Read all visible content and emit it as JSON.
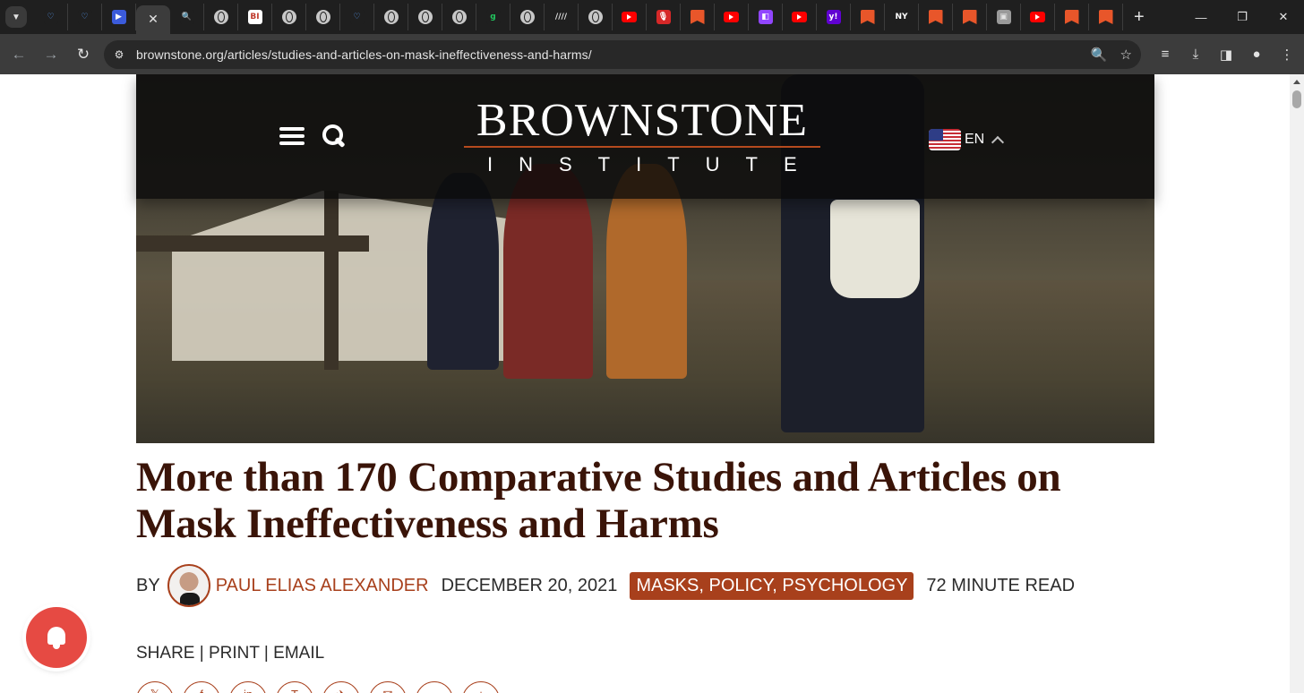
{
  "browser": {
    "tab_search_icon": "chevron-down-icon",
    "tabs": [
      {
        "icon": "bookmark-blue-icon",
        "glyph": "♡",
        "bg": "#1f1f1f",
        "fg": "#5aa0ff"
      },
      {
        "icon": "bookmark-blue-icon",
        "glyph": "♡",
        "bg": "#1f1f1f",
        "fg": "#5aa0ff"
      },
      {
        "icon": "arrow-tag-icon",
        "glyph": "▶",
        "bg": "#3b5bdb",
        "fg": "#ffffff"
      },
      {
        "icon": "close-icon",
        "glyph": "✕",
        "active": true
      },
      {
        "icon": "search-icon",
        "glyph": "🔍",
        "bg": "#1f1f1f",
        "fg": "#5aa0ff"
      },
      {
        "icon": "globe-icon"
      },
      {
        "icon": "bi-logo-icon",
        "glyph": "BI",
        "bg": "#ffffff",
        "fg": "#c0392b"
      },
      {
        "icon": "globe-icon"
      },
      {
        "icon": "globe-icon"
      },
      {
        "icon": "bookmark-blue-icon",
        "glyph": "♡",
        "bg": "#1f1f1f",
        "fg": "#5aa0ff"
      },
      {
        "icon": "globe-icon"
      },
      {
        "icon": "globe-icon"
      },
      {
        "icon": "globe-icon"
      },
      {
        "icon": "g-logo-icon",
        "glyph": "g",
        "bg": "#1f1f1f",
        "fg": "#22c55e"
      },
      {
        "icon": "globe-icon"
      },
      {
        "icon": "slashes-icon",
        "glyph": "////",
        "bg": "#1f1f1f",
        "fg": "#e3e3e3"
      },
      {
        "icon": "globe-icon"
      },
      {
        "icon": "youtube-icon"
      },
      {
        "icon": "podcast-icon",
        "glyph": "🎙",
        "bg": "#d62828",
        "fg": "#ffffff"
      },
      {
        "icon": "substack-icon"
      },
      {
        "icon": "youtube-icon"
      },
      {
        "icon": "twitch-icon",
        "glyph": "◧",
        "bg": "#9146ff",
        "fg": "#ffffff"
      },
      {
        "icon": "youtube-icon"
      },
      {
        "icon": "yahoo-icon",
        "glyph": "y!",
        "bg": "#6001d2",
        "fg": "#ffffff"
      },
      {
        "icon": "substack-icon"
      },
      {
        "icon": "nyt-icon",
        "glyph": "NY",
        "bg": "#1f1f1f",
        "fg": "#ffffff"
      },
      {
        "icon": "substack-icon"
      },
      {
        "icon": "substack-icon"
      },
      {
        "icon": "photo-icon",
        "glyph": "▣",
        "bg": "#9a9a9a",
        "fg": "#e3e3e3"
      },
      {
        "icon": "youtube-icon"
      },
      {
        "icon": "substack-icon"
      },
      {
        "icon": "substack-icon"
      }
    ],
    "new_tab_icon": "plus-icon",
    "url": "brownstone.org/articles/studies-and-articles-on-mask-ineffectiveness-and-harms/"
  },
  "site": {
    "logo_top": "BROWNSTONE",
    "logo_bottom": "INSTITUTE",
    "language": "EN",
    "accent_color": "#a8401c"
  },
  "article": {
    "title": "More than 170 Comparative Studies and Articles on Mask Ineffectiveness and Harms",
    "by_label": "BY",
    "author": "PAUL ELIAS ALEXANDER",
    "date": "DECEMBER 20, 2021",
    "tags": "MASKS, POLICY, PSYCHOLOGY",
    "read_time": "72 MINUTE READ",
    "share": {
      "share": "SHARE",
      "print": "PRINT",
      "email": "EMAIL",
      "separator": " | "
    },
    "share_icons": [
      {
        "icon": "twitter-icon",
        "glyph": "𝕏"
      },
      {
        "icon": "facebook-icon",
        "glyph": "f"
      },
      {
        "icon": "linkedin-icon",
        "glyph": "in"
      },
      {
        "icon": "truth-social-icon",
        "glyph": "T"
      },
      {
        "icon": "telegram-icon",
        "glyph": "✈"
      },
      {
        "icon": "email-icon",
        "glyph": "✉"
      },
      {
        "icon": "more-icon",
        "glyph": "…"
      },
      {
        "icon": "plus-icon",
        "glyph": "+"
      }
    ]
  }
}
